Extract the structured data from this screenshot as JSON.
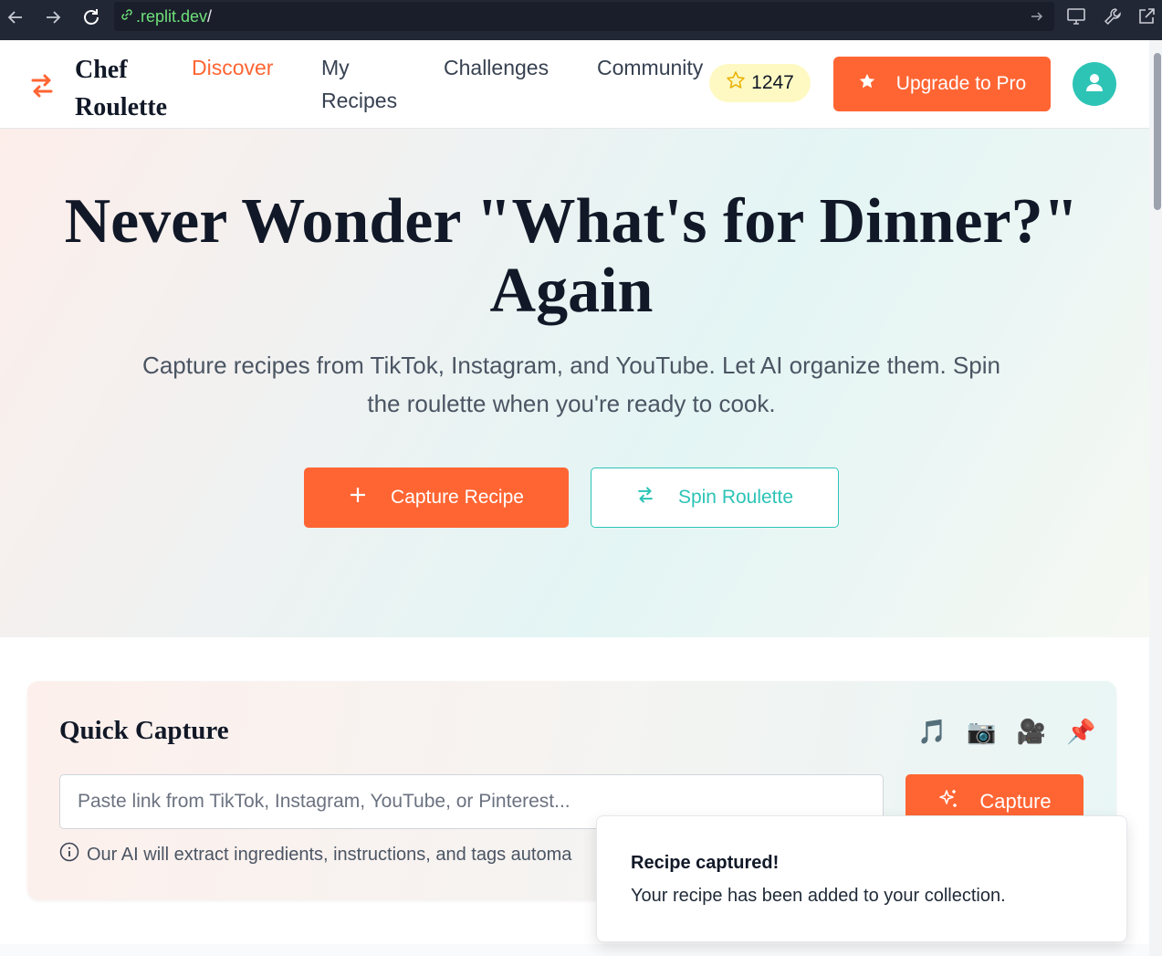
{
  "browser": {
    "url_host": ".replit.dev",
    "url_path": "/"
  },
  "header": {
    "brand_line1": "Chef",
    "brand_line2": "Roulette",
    "nav": [
      {
        "label": "Discover",
        "active": true
      },
      {
        "label": "My Recipes",
        "active": false
      },
      {
        "label": "Challenges",
        "active": false
      },
      {
        "label": "Community",
        "active": false
      }
    ],
    "points": "1247",
    "upgrade_label": "Upgrade to Pro"
  },
  "hero": {
    "title_line1": "Never Wonder \"What's for Dinner?\"",
    "title_line2": "Again",
    "subtitle_line1": "Capture recipes from TikTok, Instagram, and YouTube. Let AI organize them. Spin",
    "subtitle_line2": "the roulette when you're ready to cook.",
    "capture_label": "Capture Recipe",
    "spin_label": "Spin Roulette"
  },
  "quick_capture": {
    "title": "Quick Capture",
    "platform_icons": [
      "🎵",
      "📷",
      "🎥",
      "📌"
    ],
    "input_placeholder": "Paste link from TikTok, Instagram, YouTube, or Pinterest...",
    "button_label": "Capture",
    "note": "Our AI will extract ingredients, instructions, and tags automa"
  },
  "toast": {
    "title": "Recipe captured!",
    "body": "Your recipe has been added to your collection."
  },
  "colors": {
    "accent": "#ff6533",
    "teal": "#2dc4b6"
  }
}
